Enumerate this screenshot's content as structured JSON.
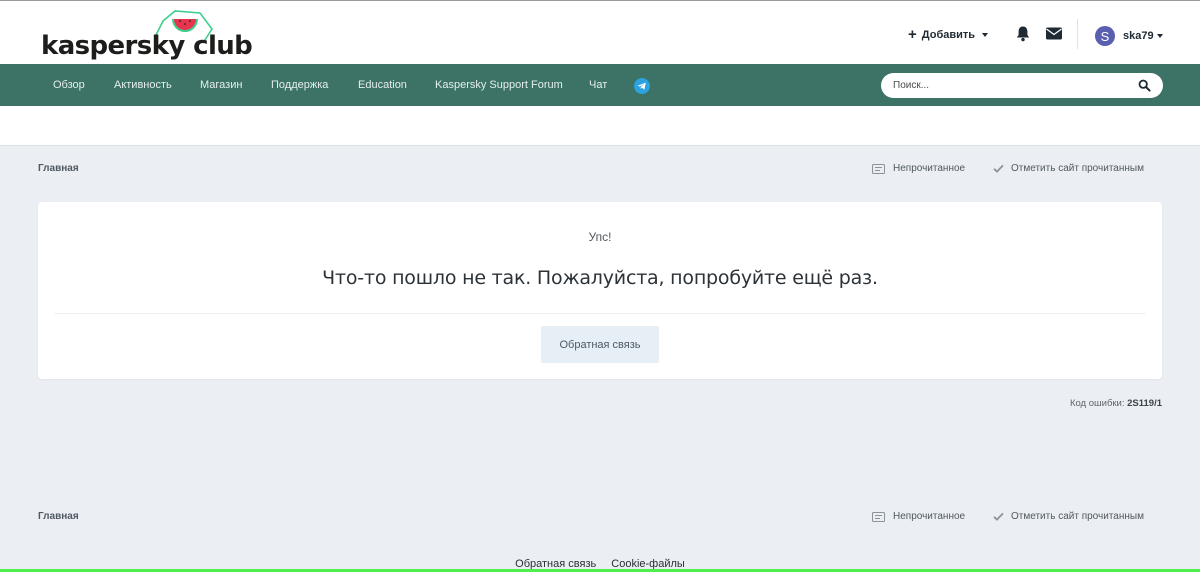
{
  "header": {
    "logo_text": "kaspersky club",
    "add_label": "Добавить",
    "user_initial": "S",
    "username": "ska79"
  },
  "nav": {
    "items": [
      {
        "label": "Обзор"
      },
      {
        "label": "Активность"
      },
      {
        "label": "Магазин"
      },
      {
        "label": "Поддержка"
      },
      {
        "label": "Education"
      },
      {
        "label": "Kaspersky Support Forum"
      },
      {
        "label": "Чат"
      }
    ],
    "search_placeholder": "Поиск..."
  },
  "breadcrumb": {
    "home": "Главная",
    "unread": "Непрочитанное",
    "mark_read": "Отметить сайт прочитанным"
  },
  "error": {
    "title": "Упс!",
    "message": "Что-то пошло не так. Пожалуйста, попробуйте ещё раз.",
    "feedback_button": "Обратная связь",
    "code_label": "Код ошибки: ",
    "code": "2S119/1"
  },
  "footer": {
    "links": [
      "Обратная связь",
      "Cookie-файлы"
    ]
  },
  "colors": {
    "navbar": "#3d7266",
    "page_bg": "#ebeef2",
    "accent_green": "#4ff04a",
    "avatar": "#5a5fb0",
    "telegram": "#2aa3e0"
  },
  "icons": [
    "plus-icon",
    "bell-icon",
    "mail-icon",
    "telegram-icon",
    "search-icon",
    "unread-icon",
    "check-icon"
  ]
}
